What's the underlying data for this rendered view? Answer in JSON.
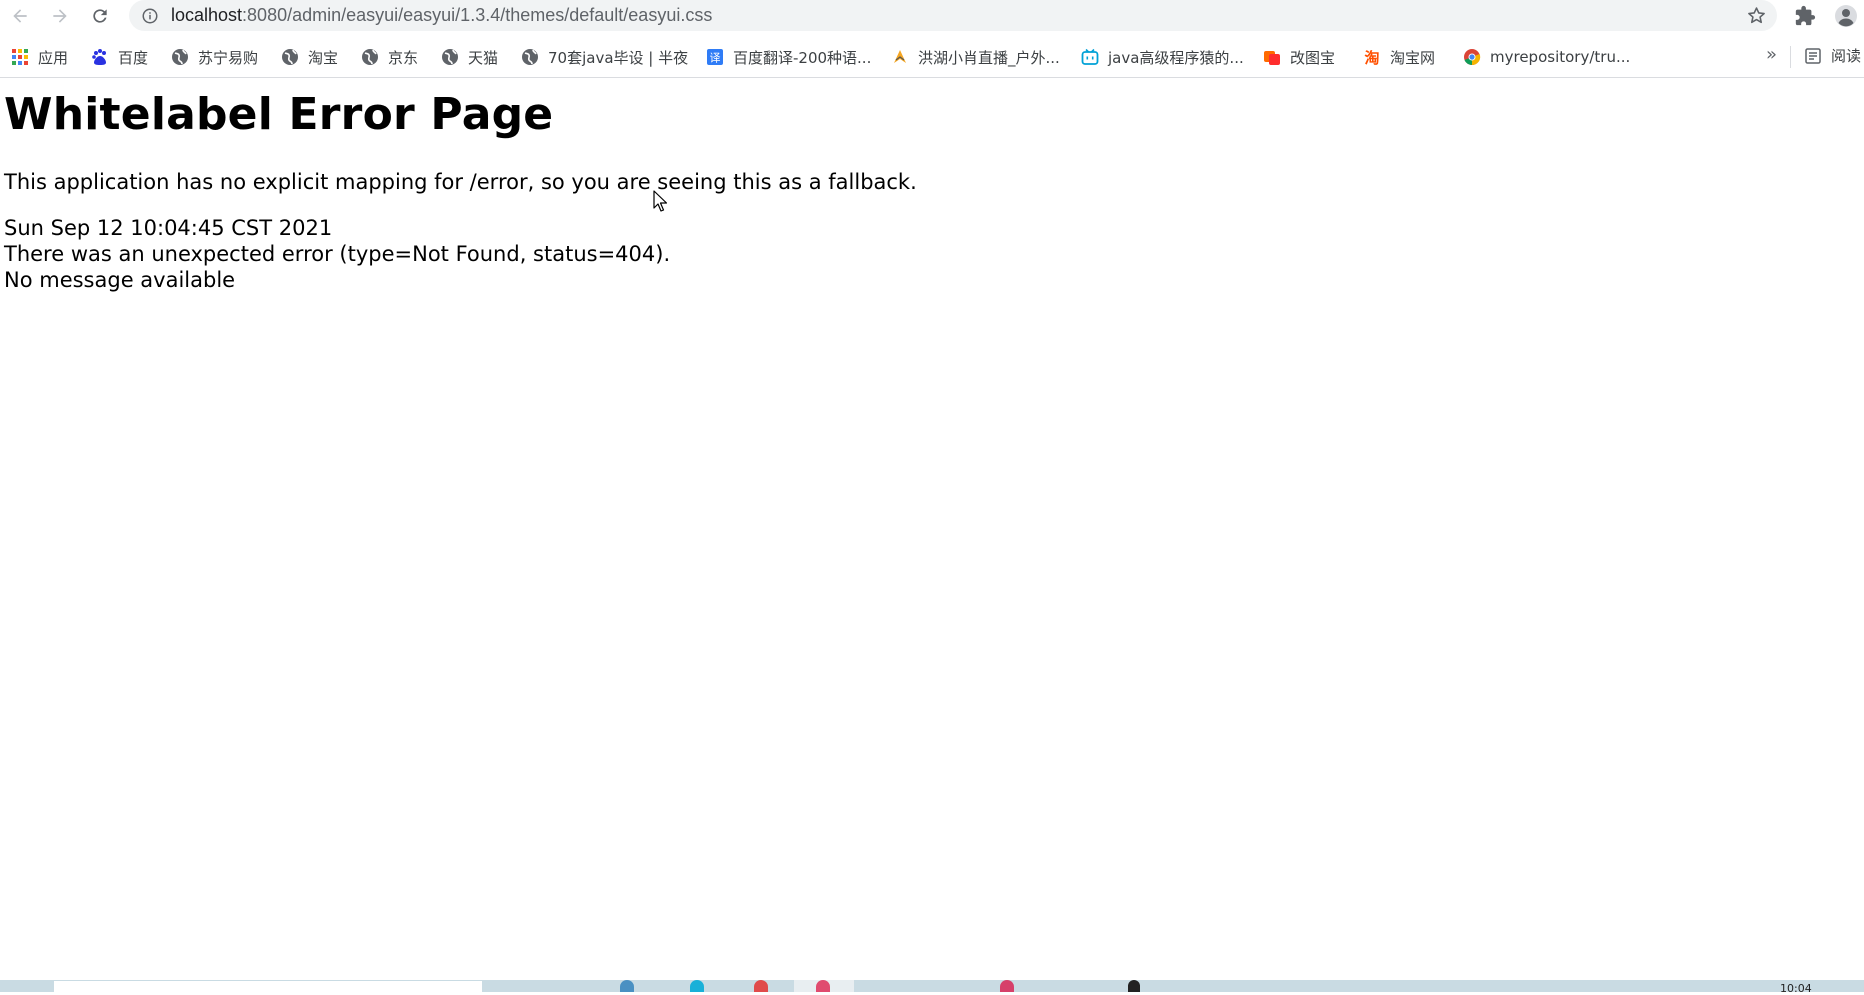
{
  "browser": {
    "url_host": "localhost",
    "url_rest": ":8080/admin/easyui/easyui/1.3.4/themes/default/easyui.css"
  },
  "bookmarks": [
    {
      "label": "应用",
      "icon": "apps-grid-icon"
    },
    {
      "label": "百度",
      "icon": "baidu-paw-icon"
    },
    {
      "label": "苏宁易购",
      "icon": "globe-icon"
    },
    {
      "label": "淘宝",
      "icon": "globe-icon"
    },
    {
      "label": "京东",
      "icon": "globe-icon"
    },
    {
      "label": "天猫",
      "icon": "globe-icon"
    },
    {
      "label": "70套java毕设 | 半夜",
      "icon": "globe-icon"
    },
    {
      "label": "百度翻译-200种语...",
      "icon": "translate-icon"
    },
    {
      "label": "洪湖小肖直播_户外...",
      "icon": "huya-icon"
    },
    {
      "label": "java高级程序猿的...",
      "icon": "bilibili-icon"
    },
    {
      "label": "改图宝",
      "icon": "gaitubao-icon"
    },
    {
      "label": "淘宝网",
      "icon": "taobao-icon"
    },
    {
      "label": "myrepository/tru...",
      "icon": "chrome-icon"
    }
  ],
  "bookmarks_more": "»",
  "reading_list": "阅读",
  "page": {
    "title": "Whitelabel Error Page",
    "message": "This application has no explicit mapping for /error, so you are seeing this as a fallback.",
    "timestamp": "Sun Sep 12 10:04:45 CST 2021",
    "error": "There was an unexpected error (type=Not Found, status=404).",
    "detail": "No message available"
  },
  "taskbar": {
    "clock": "10:04"
  }
}
